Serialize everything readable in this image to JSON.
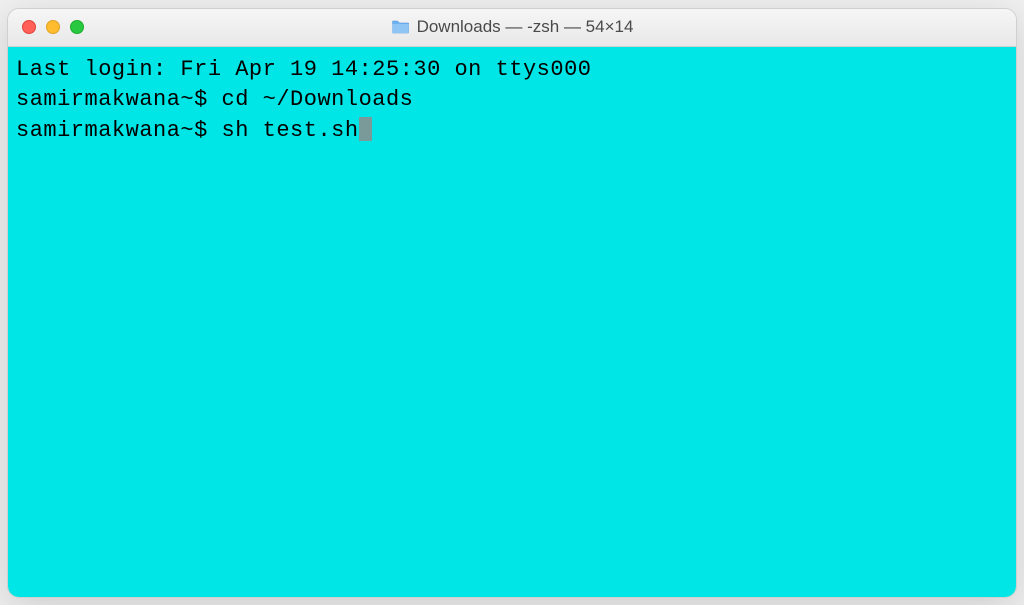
{
  "window": {
    "title": "Downloads — -zsh — 54×14"
  },
  "terminal": {
    "lines": [
      {
        "text": "Last login: Fri Apr 19 14:25:30 on ttys000"
      },
      {
        "prompt": "samirmakwana~$ ",
        "command": "cd ~/Downloads"
      },
      {
        "prompt": "samirmakwana~$ ",
        "command": "sh test.sh",
        "cursor": true
      }
    ]
  }
}
